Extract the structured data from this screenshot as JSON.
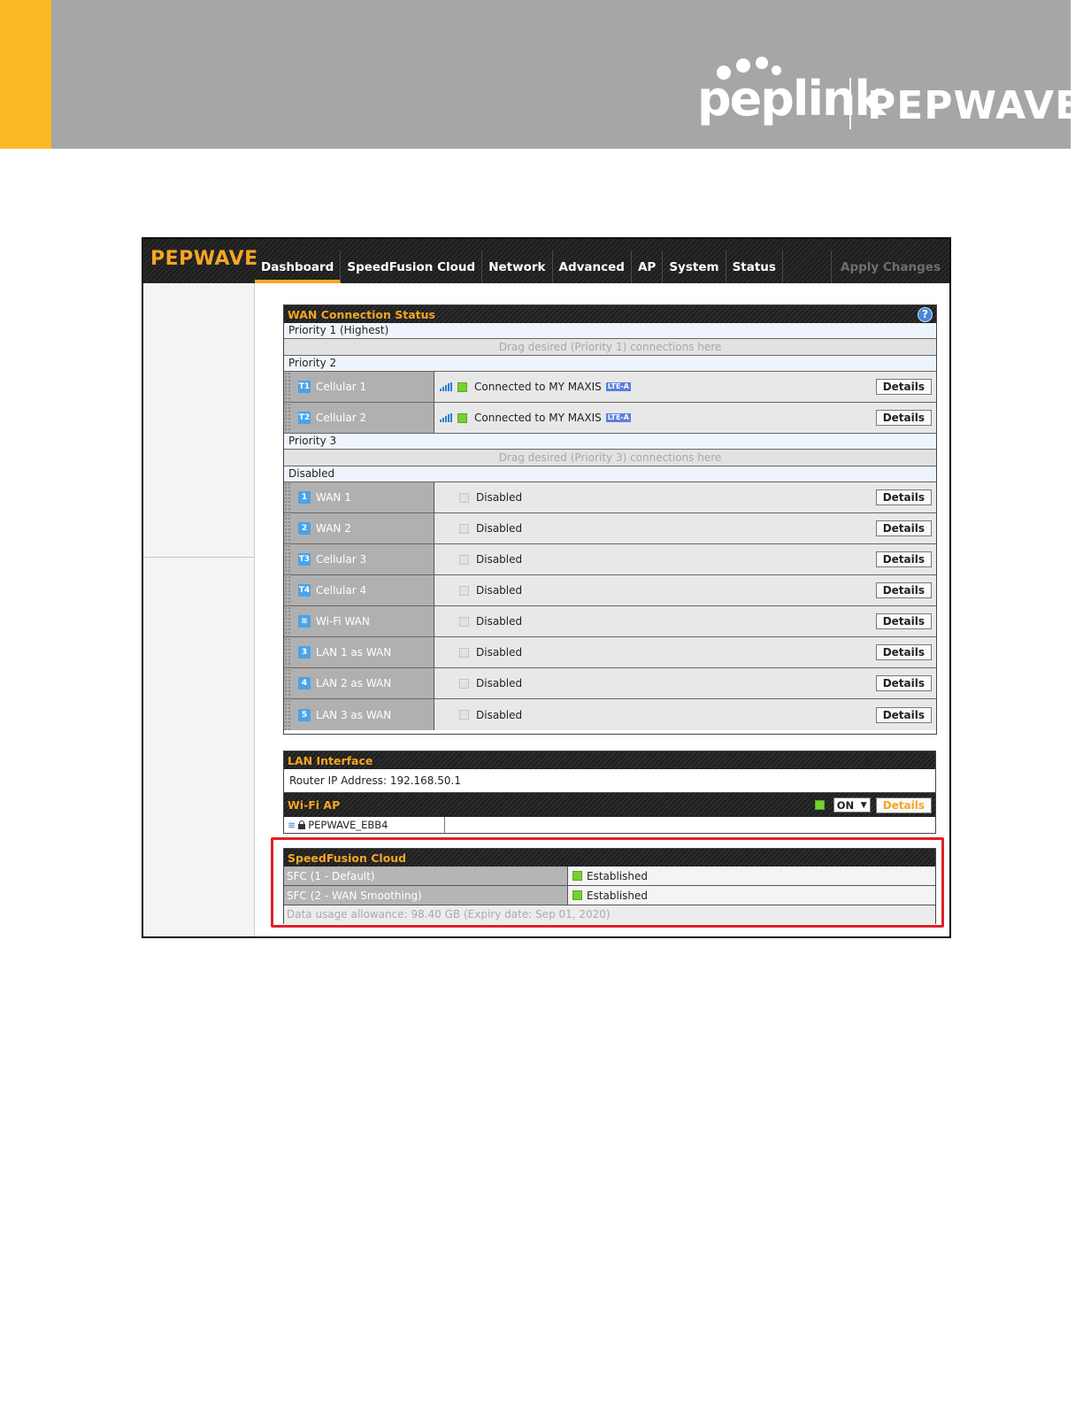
{
  "banner": {
    "logo_left": "peplink",
    "logo_right": "PEPWAVE",
    "accent_color": "#fdb924",
    "band_color": "#a6a6a6"
  },
  "app": {
    "brand": "PEPWAVE",
    "nav": [
      "Dashboard",
      "SpeedFusion Cloud",
      "Network",
      "Advanced",
      "AP",
      "System",
      "Status"
    ],
    "active_tab": "Dashboard",
    "apply_label": "Apply Changes",
    "accent_color": "#f5a623"
  },
  "wan": {
    "title": "WAN Connection Status",
    "help_icon": "question-mark-icon",
    "priority1": {
      "label": "Priority 1 (Highest)",
      "drop": "Drag desired (Priority 1) connections here"
    },
    "priority2": {
      "label": "Priority 2",
      "rows": [
        {
          "icon": "T1",
          "name": "Cellular 1",
          "status": "Connected to MY MAXIS",
          "badge": "LTE-A",
          "details": "Details"
        },
        {
          "icon": "T2",
          "name": "Cellular 2",
          "status": "Connected to MY MAXIS",
          "badge": "LTE-A",
          "details": "Details"
        }
      ]
    },
    "priority3": {
      "label": "Priority 3",
      "drop": "Drag desired (Priority 3) connections here"
    },
    "disabled": {
      "label": "Disabled",
      "rows": [
        {
          "icon": "1",
          "name": "WAN 1",
          "status": "Disabled",
          "details": "Details"
        },
        {
          "icon": "2",
          "name": "WAN 2",
          "status": "Disabled",
          "details": "Details"
        },
        {
          "icon": "T3",
          "name": "Cellular 3",
          "status": "Disabled",
          "details": "Details"
        },
        {
          "icon": "T4",
          "name": "Cellular 4",
          "status": "Disabled",
          "details": "Details"
        },
        {
          "icon": "wifi",
          "name": "Wi-Fi WAN",
          "status": "Disabled",
          "details": "Details"
        },
        {
          "icon": "3",
          "name": "LAN 1 as WAN",
          "status": "Disabled",
          "details": "Details"
        },
        {
          "icon": "4",
          "name": "LAN 2 as WAN",
          "status": "Disabled",
          "details": "Details"
        },
        {
          "icon": "5",
          "name": "LAN 3 as WAN",
          "status": "Disabled",
          "details": "Details"
        }
      ]
    }
  },
  "lan": {
    "title": "LAN Interface",
    "router_ip": "Router IP Address: 192.168.50.1"
  },
  "wifi_ap": {
    "title": "Wi-Fi AP",
    "state": "ON",
    "details": "Details",
    "ssid": "PEPWAVE_EBB4"
  },
  "sfc": {
    "title": "SpeedFusion Cloud",
    "rows": [
      {
        "name": "SFC (1 - Default)",
        "status": "Established"
      },
      {
        "name": "SFC (2 - WAN Smoothing)",
        "status": "Established"
      }
    ],
    "usage": "Data usage allowance: 98.40 GB (Expiry date: Sep 01, 2020)"
  }
}
